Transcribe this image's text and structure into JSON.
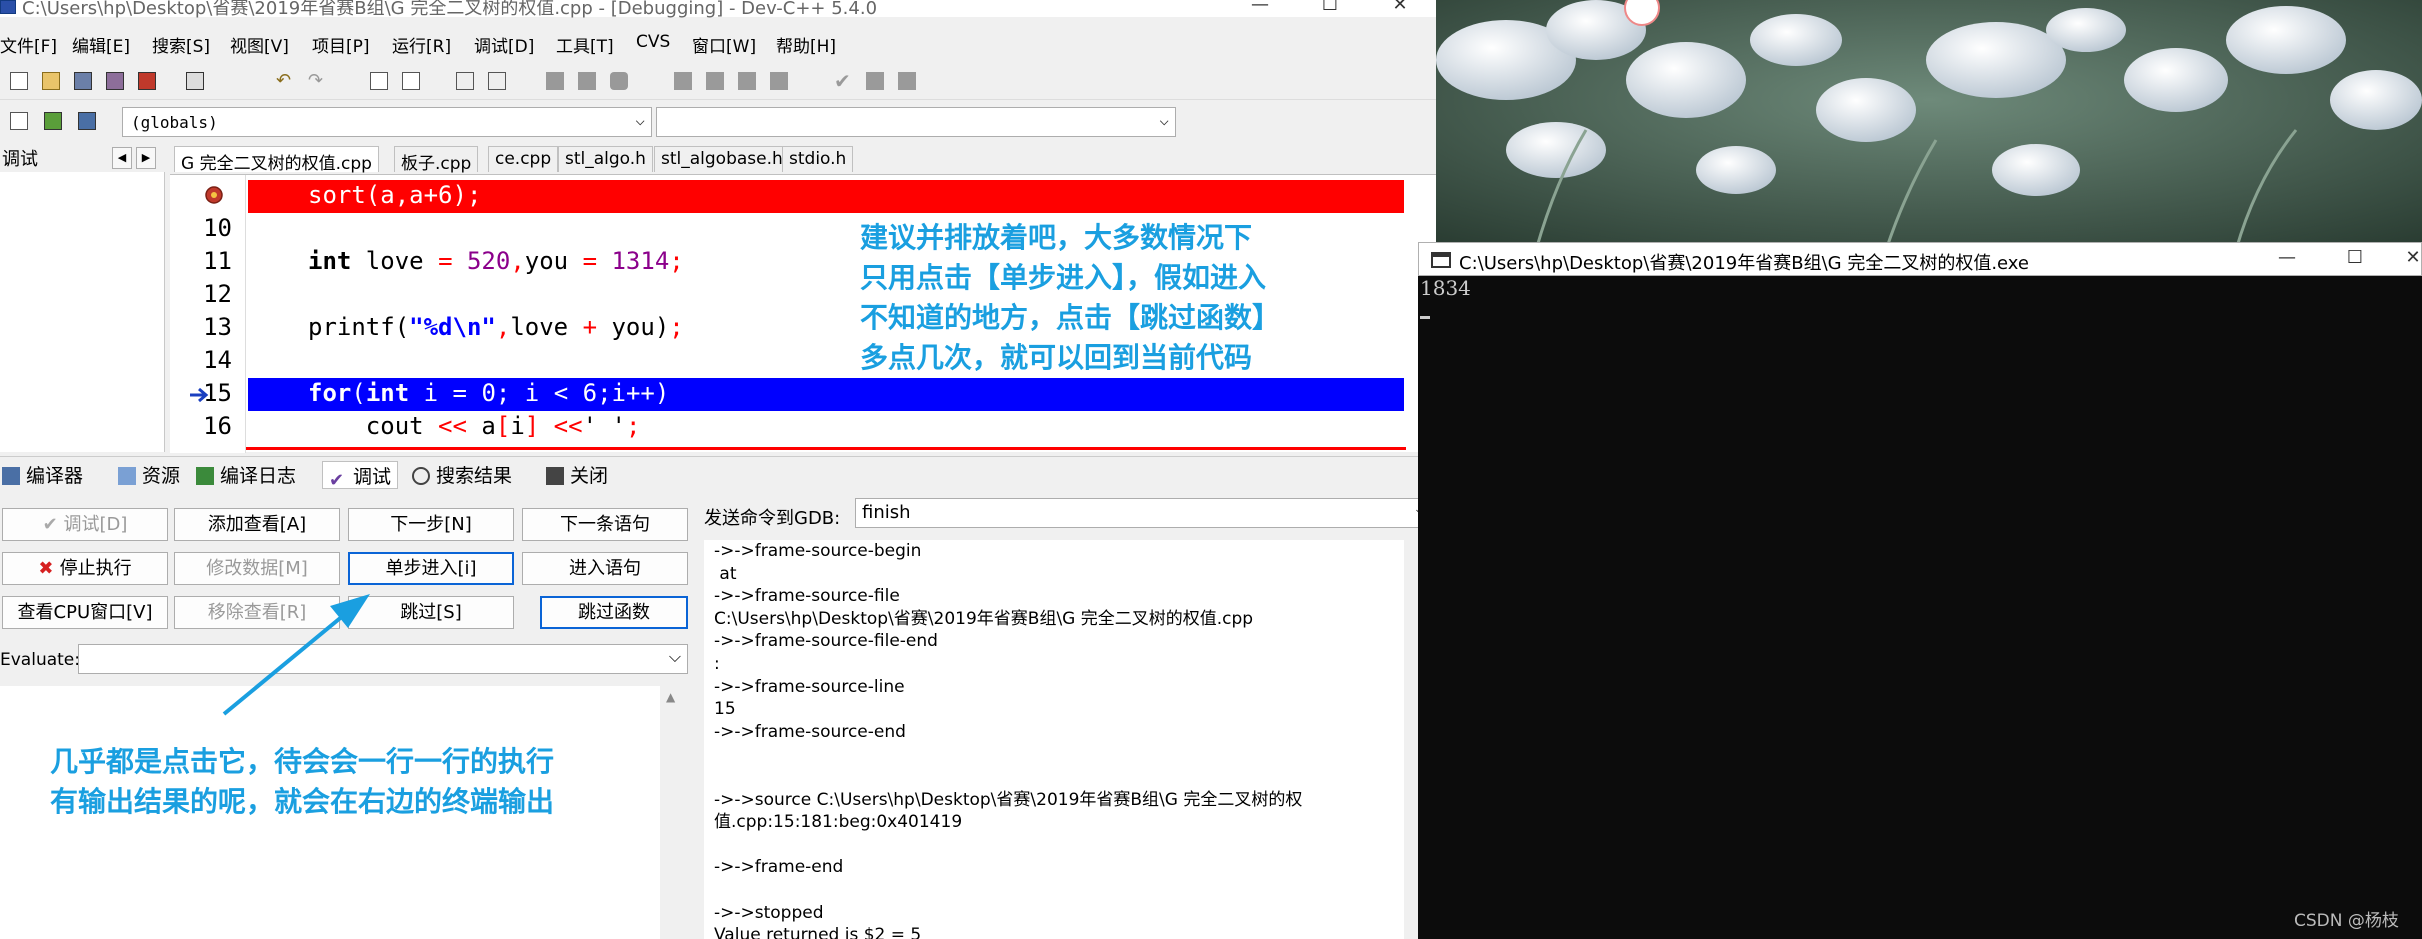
{
  "window": {
    "title": "C:\\Users\\hp\\Desktop\\省赛\\2019年省赛B组\\G 完全二叉树的权值.cpp - [Debugging] - Dev-C++ 5.4.0",
    "min": "—",
    "max": "☐",
    "close": "✕"
  },
  "menu": [
    "文件[F]",
    "编辑[E]",
    "搜索[S]",
    "视图[V]",
    "项目[P]",
    "运行[R]",
    "调试[D]",
    "工具[T]",
    "CVS",
    "窗口[W]",
    "帮助[H]"
  ],
  "scope_combo": {
    "value": "(globals)",
    "arrow": "⌵"
  },
  "left_panel": {
    "label": "调试",
    "prev": "◀",
    "next": "▶"
  },
  "file_tabs": [
    "G 完全二叉树的权值.cpp",
    "板子.cpp",
    "ce.cpp",
    "stl_algo.h",
    "stl_algobase.h",
    "stdio.h"
  ],
  "code_lines": [
    {
      "num": "",
      "text": "sort(a,a+6);",
      "highlight": "breakpoint"
    },
    {
      "num": "10",
      "text": ""
    },
    {
      "num": "11",
      "text": "int love = 520,you = 1314;"
    },
    {
      "num": "12",
      "text": ""
    },
    {
      "num": "13",
      "text": "printf(\"%d\\n\",love + you);"
    },
    {
      "num": "14",
      "text": ""
    },
    {
      "num": "15",
      "text": "for(int i = 0; i < 6;i++)",
      "highlight": "current"
    },
    {
      "num": "16",
      "text": "    cout << a[i] <<' ';"
    }
  ],
  "annotation_top": [
    "建议并排放着吧，大多数情况下",
    "只用点击【单步进入】，假如进入",
    "不知道的地方，点击【跳过函数】",
    "多点几次，就可以回到当前代码"
  ],
  "annotation_bottom": [
    "几乎都是点击它，待会会一行一行的执行",
    "有输出结果的呢，就会在右边的终端输出"
  ],
  "bottom_tabs": [
    "编译器",
    "资源",
    "编译日志",
    "调试",
    "搜索结果",
    "关闭"
  ],
  "debug_buttons": {
    "debug": "调试[D]",
    "add_watch": "添加查看[A]",
    "next_step": "下一步[N]",
    "next_stmt": "下一条语句",
    "stop": "停止执行",
    "modify": "修改数据[M]",
    "step_into": "单步进入[i]",
    "into_stmt": "进入语句",
    "cpu": "查看CPU窗口[V]",
    "remove_watch": "移除查看[R]",
    "skip": "跳过[S]",
    "skip_func": "跳过函数"
  },
  "evaluate_label": "Evaluate:",
  "gdb": {
    "label": "发送命令到GDB:",
    "value": "finish",
    "output": "->->frame-source-begin\n at\n->->frame-source-file\nC:\\Users\\hp\\Desktop\\省赛\\2019年省赛B组\\G 完全二叉树的权值.cpp\n->->frame-source-file-end\n:\n->->frame-source-line\n15\n->->frame-source-end\n\n\n->->source C:\\Users\\hp\\Desktop\\省赛\\2019年省赛B组\\G 完全二叉树的权\n值.cpp:15:181:beg:0x401419\n\n->->frame-end\n\n->->stopped\nValue returned is $2 = 5"
  },
  "console": {
    "title": "C:\\Users\\hp\\Desktop\\省赛\\2019年省赛B组\\G 完全二叉树的权值.exe",
    "output": "1834",
    "min": "—",
    "max": "☐",
    "close": "✕"
  },
  "watermark": "CSDN @杨枝",
  "colors": {
    "breakpoint_line": "#ff0000",
    "current_line": "#0000ff",
    "annotation": "#1a9fe0",
    "console_bg": "#0c0c0c"
  }
}
